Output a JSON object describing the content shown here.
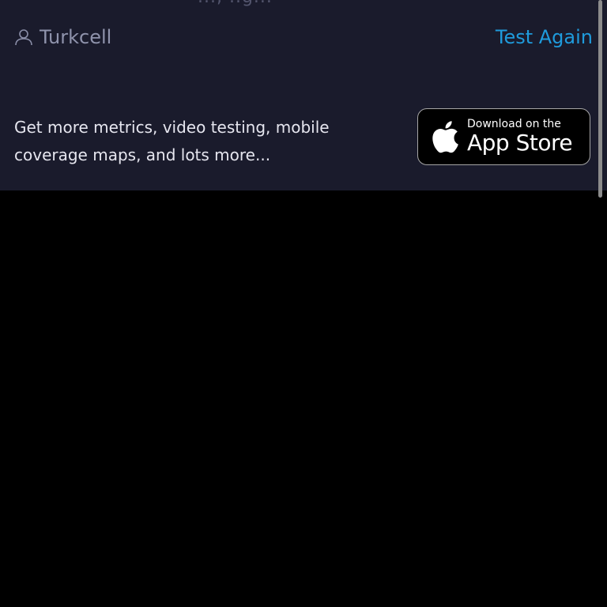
{
  "header": {
    "cut_off_text": "..., ..g..."
  },
  "result": {
    "provider_icon": "person-icon",
    "provider_name": "Turkcell",
    "test_again_label": "Test Again"
  },
  "promo": {
    "text": "Get more metrics, video testing, mobile coverage maps, and lots more...",
    "badge_small": "Download on the",
    "badge_large": "App Store",
    "badge_icon": "apple-icon"
  },
  "colors": {
    "panel_background": "#1a1b2c",
    "accent": "#1f9bdc",
    "page_background": "#000000"
  }
}
